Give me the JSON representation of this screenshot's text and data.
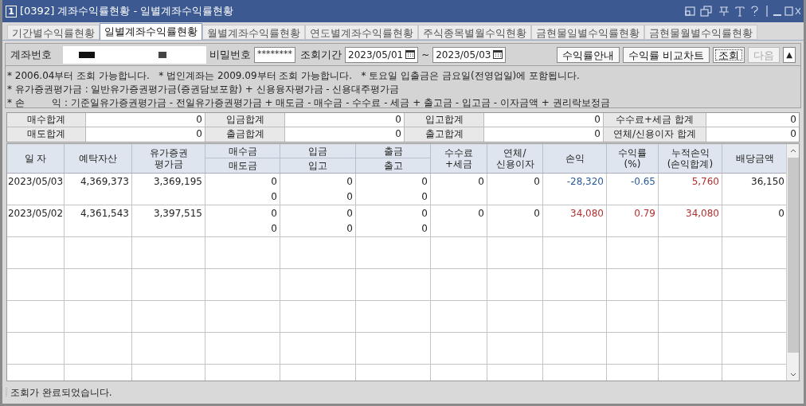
{
  "window": {
    "number": "1",
    "title": "[0392] 계좌수익률현황 - 일별계좌수익률현황"
  },
  "tabs": [
    {
      "label": "기간별수익률현황",
      "selected": false
    },
    {
      "label": "일별계좌수익률현황",
      "selected": true
    },
    {
      "label": "월별계좌수익률현황",
      "selected": false
    },
    {
      "label": "연도별계좌수익률현황",
      "selected": false
    },
    {
      "label": "주식종목별월수익현황",
      "selected": false
    },
    {
      "label": "금현물일별수익률현황",
      "selected": false
    },
    {
      "label": "금현물월별수익률현황",
      "selected": false
    }
  ],
  "query": {
    "account_label": "계좌번호",
    "password_label": "비밀번호",
    "password_value": "********",
    "period_label": "조회기간",
    "start_date": "2023/05/01",
    "separator": "~",
    "end_date": "2023/05/03",
    "buttons": [
      {
        "label": "수익률안내",
        "disabled": false,
        "focused": false
      },
      {
        "label": "수익률 비교차트",
        "disabled": false,
        "focused": false
      },
      {
        "label": "조회",
        "disabled": false,
        "focused": true
      },
      {
        "label": "다음",
        "disabled": true,
        "focused": false
      }
    ],
    "collapse": "▲"
  },
  "notes": [
    "* 2006.04부터 조회 가능합니다.   * 법인계좌는 2009.09부터 조회 가능합니다.   * 토요일 입출금은 금요일(전영업일)에 포함됩니다.",
    "* 유가증권평가금 : 일반유가증권평가금(증권담보포함) + 신용융자평가금 - 신용대주평가금",
    "* 손         익 : 기준일유가증권평가금 - 전일유가증권평가금 + 매도금 - 매수금 - 수수료 - 세금 + 출고금 - 입고금 - 이자금액 + 권리락보정금"
  ],
  "summary": [
    [
      {
        "label": "매수합계",
        "value": "0"
      },
      {
        "label": "입금합계",
        "value": "0"
      },
      {
        "label": "입고합계",
        "value": "0"
      },
      {
        "label": "수수료+세금 합계",
        "value": "0"
      }
    ],
    [
      {
        "label": "매도합계",
        "value": "0"
      },
      {
        "label": "출금합계",
        "value": "0"
      },
      {
        "label": "출고합계",
        "value": "0"
      },
      {
        "label": "연체/신용이자 합계",
        "value": "0"
      }
    ]
  ],
  "grid": {
    "columns": [
      {
        "kind": "single",
        "label": "일 자"
      },
      {
        "kind": "single",
        "label": "예탁자산"
      },
      {
        "kind": "single",
        "label": "유가증권\n평가금"
      },
      {
        "kind": "split",
        "top": "매수금",
        "bottom": "매도금"
      },
      {
        "kind": "split",
        "top": "입금",
        "bottom": "입고"
      },
      {
        "kind": "split",
        "top": "출금",
        "bottom": "출고"
      },
      {
        "kind": "single",
        "label": "수수료\n+세금"
      },
      {
        "kind": "single",
        "label": "연체/\n신용이자"
      },
      {
        "kind": "single",
        "label": "손익"
      },
      {
        "kind": "single",
        "label": "수익률\n(%)"
      },
      {
        "kind": "single",
        "label": "누적손익\n(손익합계)"
      },
      {
        "kind": "single",
        "label": "배당금액"
      }
    ],
    "rows": [
      [
        {
          "lines": [
            "2023/05/03"
          ]
        },
        {
          "lines": [
            "4,369,373"
          ]
        },
        {
          "lines": [
            "3,369,195"
          ]
        },
        {
          "lines": [
            "0",
            "0"
          ]
        },
        {
          "lines": [
            "0",
            "0"
          ]
        },
        {
          "lines": [
            "0",
            "0"
          ]
        },
        {
          "lines": [
            "0"
          ]
        },
        {
          "lines": [
            "0"
          ]
        },
        {
          "lines": [
            "-28,320"
          ],
          "color": "#2a5a9a"
        },
        {
          "lines": [
            "-0.65"
          ],
          "color": "#2a5a9a"
        },
        {
          "lines": [
            "5,760"
          ],
          "color": "#b03030"
        },
        {
          "lines": [
            "36,150"
          ]
        }
      ],
      [
        {
          "lines": [
            "2023/05/02"
          ]
        },
        {
          "lines": [
            "4,361,543"
          ]
        },
        {
          "lines": [
            "3,397,515"
          ]
        },
        {
          "lines": [
            "0",
            "0"
          ]
        },
        {
          "lines": [
            "0",
            "0"
          ]
        },
        {
          "lines": [
            "0",
            "0"
          ]
        },
        {
          "lines": [
            "0"
          ]
        },
        {
          "lines": [
            "0"
          ]
        },
        {
          "lines": [
            "34,080"
          ],
          "color": "#b03030"
        },
        {
          "lines": [
            "0.79"
          ],
          "color": "#b03030"
        },
        {
          "lines": [
            "34,080"
          ],
          "color": "#b03030"
        },
        {
          "lines": [
            "0"
          ]
        }
      ]
    ]
  },
  "status": "조회가 완료되었습니다."
}
